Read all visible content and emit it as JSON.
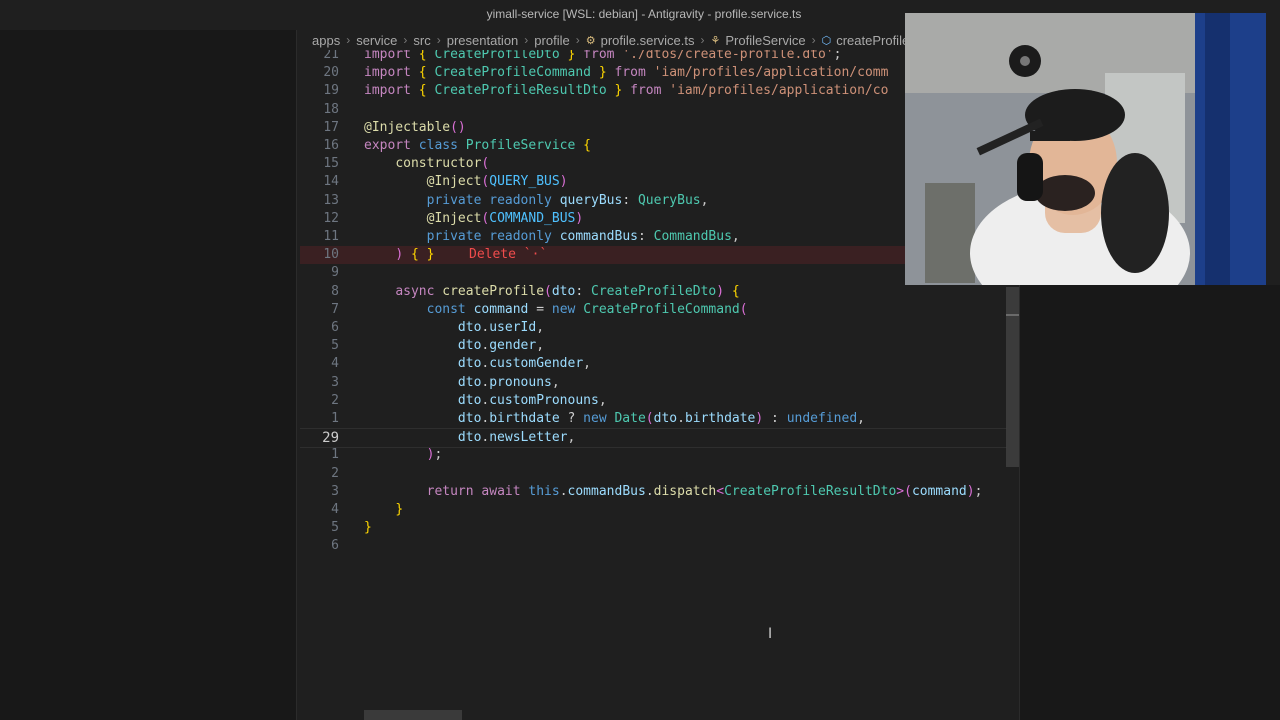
{
  "window": {
    "title": "yimall-service [WSL: debian] - Antigravity - profile.service.ts"
  },
  "breadcrumb": [
    {
      "label": "apps"
    },
    {
      "label": "service"
    },
    {
      "label": "src"
    },
    {
      "label": "presentation"
    },
    {
      "label": "profile"
    },
    {
      "label": "profile.service.ts",
      "icon": "typescript-file-icon"
    },
    {
      "label": "ProfileService",
      "icon": "class-icon"
    },
    {
      "label": "createProfile",
      "icon": "method-icon"
    }
  ],
  "editor": {
    "current_line": "29",
    "inline_hint": "Delete `·`",
    "lines": [
      {
        "num": "21",
        "code": "import { CreateProfileDto } from './dtos/create-profile.dto';"
      },
      {
        "num": "20",
        "code": "import { CreateProfileCommand } from 'iam/profiles/application/comm"
      },
      {
        "num": "19",
        "code": "import { CreateProfileResultDto } from 'iam/profiles/application/co"
      },
      {
        "num": "18",
        "code": ""
      },
      {
        "num": "17",
        "code": "@Injectable()"
      },
      {
        "num": "16",
        "code": "export class ProfileService {"
      },
      {
        "num": "15",
        "code": "    constructor("
      },
      {
        "num": "14",
        "code": "        @Inject(QUERY_BUS)"
      },
      {
        "num": "13",
        "code": "        private readonly queryBus: QueryBus,"
      },
      {
        "num": "12",
        "code": "        @Inject(COMMAND_BUS)"
      },
      {
        "num": "11",
        "code": "        private readonly commandBus: CommandBus,"
      },
      {
        "num": "10",
        "code": "    ) { }"
      },
      {
        "num": "9",
        "code": ""
      },
      {
        "num": "8",
        "code": "    async createProfile(dto: CreateProfileDto) {"
      },
      {
        "num": "7",
        "code": "        const command = new CreateProfileCommand("
      },
      {
        "num": "6",
        "code": "            dto.userId,"
      },
      {
        "num": "5",
        "code": "            dto.gender,"
      },
      {
        "num": "4",
        "code": "            dto.customGender,"
      },
      {
        "num": "3",
        "code": "            dto.pronouns,"
      },
      {
        "num": "2",
        "code": "            dto.customPronouns,"
      },
      {
        "num": "1",
        "code": "            dto.birthdate ? new Date(dto.birthdate) : undefined,"
      },
      {
        "num": "29",
        "code": "            dto.newsLetter,"
      },
      {
        "num": "1",
        "code": "        );"
      },
      {
        "num": "2",
        "code": ""
      },
      {
        "num": "3",
        "code": "        return await this.commandBus.dispatch<CreateProfileResultDto>(command);"
      },
      {
        "num": "4",
        "code": "    }"
      },
      {
        "num": "5",
        "code": "}"
      },
      {
        "num": "6",
        "code": ""
      }
    ]
  },
  "colors": {
    "keyword": "#569cd6",
    "control": "#c586c0",
    "type": "#4ec9b0",
    "function": "#dcdcaa",
    "variable": "#9cdcfe",
    "string": "#ce9178",
    "decorator": "#dcdcaa",
    "error": "#f14c4c"
  }
}
